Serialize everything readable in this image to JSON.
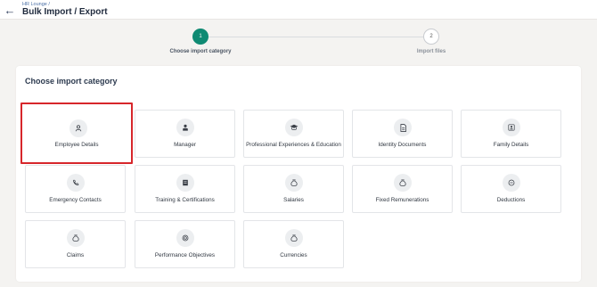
{
  "header": {
    "breadcrumb": "HR Lounge /",
    "title": "Bulk Import / Export"
  },
  "stepper": {
    "steps": [
      {
        "number": "1",
        "label": "Choose import category",
        "active": true
      },
      {
        "number": "2",
        "label": "Import files",
        "active": false
      }
    ]
  },
  "panel": {
    "title": "Choose import category",
    "categories": [
      {
        "label": "Employee Details",
        "icon": "person-icon",
        "selected": true
      },
      {
        "label": "Manager",
        "icon": "manager-icon"
      },
      {
        "label": "Professional Experiences & Education",
        "icon": "graduation-cap-icon"
      },
      {
        "label": "Identity Documents",
        "icon": "document-icon"
      },
      {
        "label": "Family Details",
        "icon": "family-icon"
      },
      {
        "label": "Emergency Contacts",
        "icon": "phone-icon"
      },
      {
        "label": "Training & Certifications",
        "icon": "certificate-icon"
      },
      {
        "label": "Salaries",
        "icon": "money-bag-icon"
      },
      {
        "label": "Fixed Remunerations",
        "icon": "money-bag-icon"
      },
      {
        "label": "Deductions",
        "icon": "minus-circle-icon"
      },
      {
        "label": "Claims",
        "icon": "money-bag-icon"
      },
      {
        "label": "Performance Objectives",
        "icon": "target-icon"
      },
      {
        "label": "Currencies",
        "icon": "money-bag-icon"
      }
    ]
  },
  "colors": {
    "accent": "#0f8a73",
    "selection_border": "#d7262b"
  }
}
